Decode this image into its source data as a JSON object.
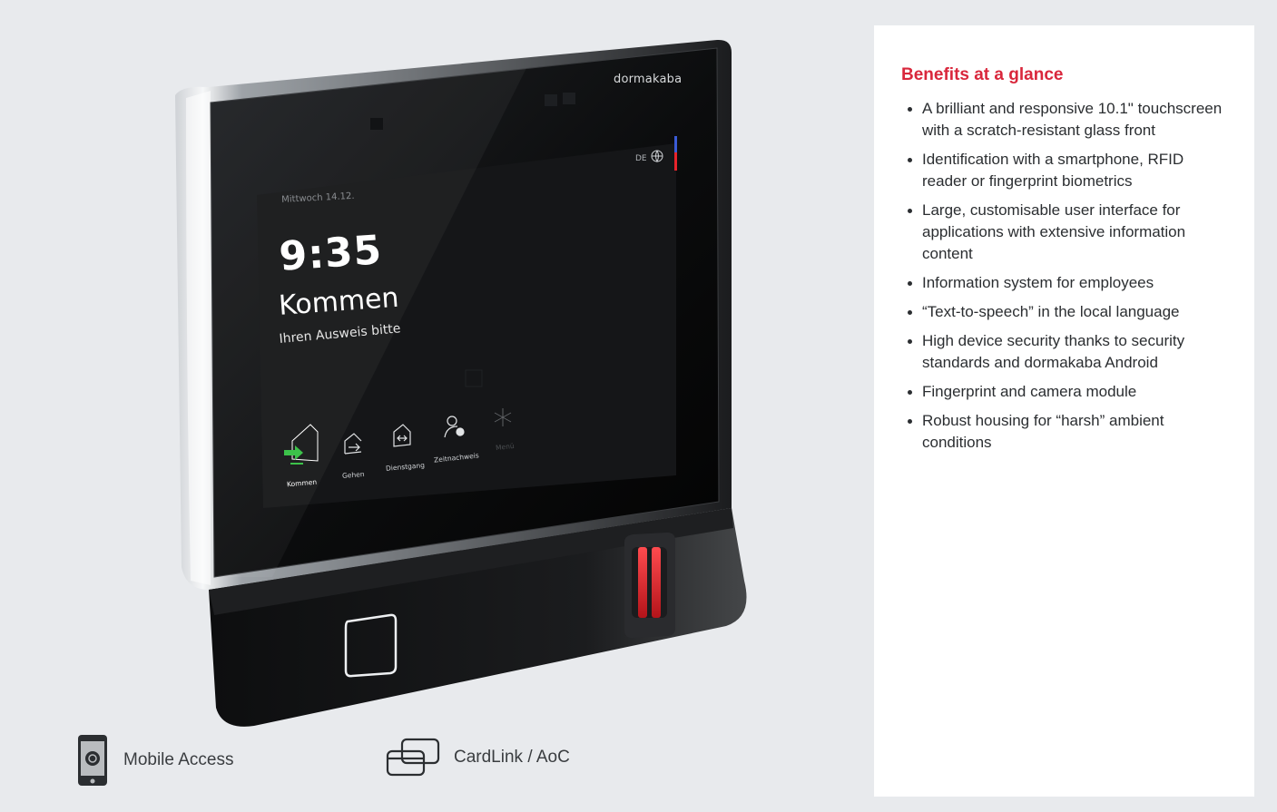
{
  "device": {
    "brand": "dormakaba",
    "screen": {
      "date": "Mittwoch 14.12.",
      "time": "9:35",
      "status": "Kommen",
      "prompt": "Ihren Ausweis bitte",
      "language": "DE",
      "buttons": [
        {
          "label": "Kommen",
          "icon": "enter-arrow-icon",
          "state": "active"
        },
        {
          "label": "Gehen",
          "icon": "exit-arrow-icon",
          "state": "normal"
        },
        {
          "label": "Dienstgang",
          "icon": "business-trip-icon",
          "state": "normal"
        },
        {
          "label": "Zeitnachweis",
          "icon": "time-record-icon",
          "state": "normal"
        },
        {
          "label": "Menü",
          "icon": "menu-star-icon",
          "state": "dim"
        }
      ]
    },
    "accent_colors": {
      "led": "#e8232b",
      "brand_red": "#d9273c"
    }
  },
  "features": [
    {
      "label": "Mobile Access",
      "icon": "mobile-phone-icon"
    },
    {
      "label": "CardLink / AoC",
      "icon": "cardlink-icon"
    }
  ],
  "benefits": {
    "title": "Benefits at a glance",
    "items": [
      "A brilliant and responsive 10.1\" touchscreen with a scratch-resistant glass front",
      "Identification with a smartphone, RFID reader or fingerprint biometrics",
      "Large, customisable user interface for applications with extensive information content",
      "Information system for employees",
      "“Text-to-speech” in the local language",
      "High device security thanks to security standards and dormakaba Android",
      "Fingerprint and camera module",
      "Robust housing for “harsh” ambient conditions"
    ]
  }
}
